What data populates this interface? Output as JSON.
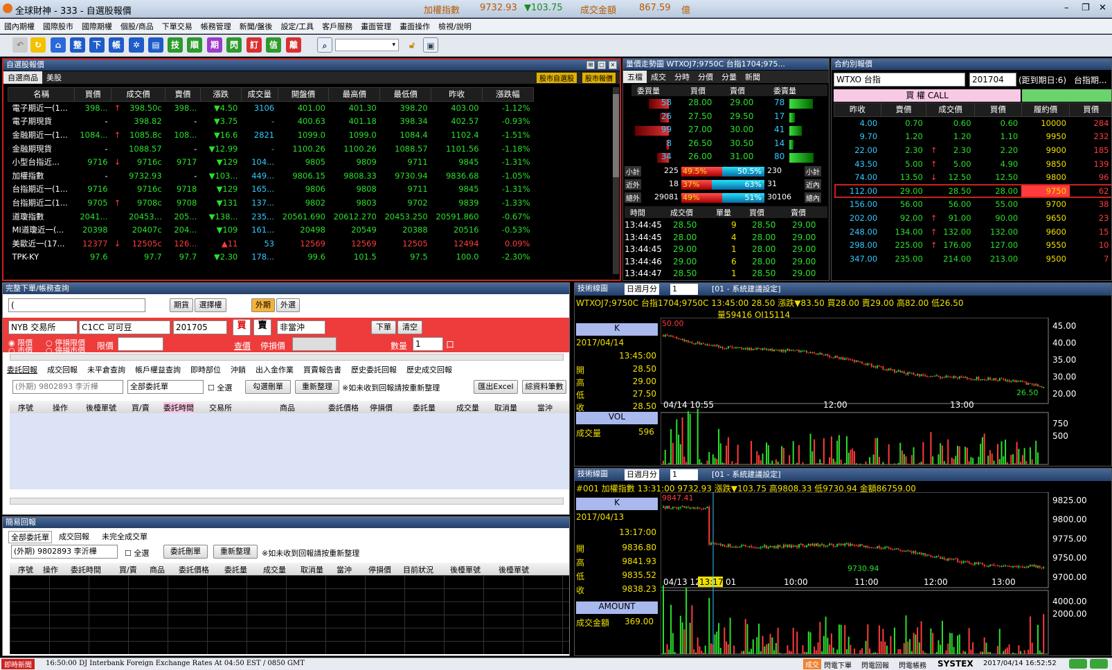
{
  "window": {
    "title": "全球財神 - 333 - 自選股報價",
    "index_label": "加權指數",
    "index_value": "9732.93",
    "index_change": "▼103.75",
    "turnover_label": "成交金額",
    "turnover_value": "867.59",
    "turnover_unit": "億",
    "minimize": "–",
    "restore": "❐",
    "close": "✕"
  },
  "menu": [
    "國內期權",
    "國際股市",
    "國際期權",
    "個股/商品",
    "下單交易",
    "帳務管理",
    "新聞/盤後",
    "設定/工具",
    "客戶服務",
    "畫面管理",
    "畫面操作",
    "檢視/說明"
  ],
  "toolbar": {
    "buttons": [
      "整",
      "下",
      "帳",
      "技",
      "順",
      "期",
      "閃",
      "訂",
      "信",
      "離"
    ]
  },
  "watch": {
    "title": "自選股報價",
    "tabs": [
      "自選商品",
      "美股"
    ],
    "tag1": "股市自選股",
    "tag2": "股市報價",
    "columns": [
      "名稱",
      "買價",
      "成交價",
      "賣價",
      "漲跌",
      "成交量",
      "開盤價",
      "最高價",
      "最低價",
      "昨收",
      "漲跌幅"
    ],
    "rows": [
      {
        "name": "電子期近一(1...",
        "bid": "398...",
        "arrow": "↑",
        "last": "398.50c",
        "ask": "398...",
        "chg": "▼4.50",
        "vol": "3106",
        "open": "401.00",
        "high": "401.30",
        "low": "398.20",
        "prev": "403.00",
        "pct": "-1.12%"
      },
      {
        "name": "電子期現貨",
        "bid": "-",
        "arrow": "",
        "last": "398.82",
        "ask": "-",
        "chg": "▼3.75",
        "vol": "-",
        "open": "400.63",
        "high": "401.18",
        "low": "398.34",
        "prev": "402.57",
        "pct": "-0.93%"
      },
      {
        "name": "金融期近一(1...",
        "bid": "1084...",
        "arrow": "↑",
        "last": "1085.8c",
        "ask": "108...",
        "chg": "▼16.6",
        "vol": "2821",
        "open": "1099.0",
        "high": "1099.0",
        "low": "1084.4",
        "prev": "1102.4",
        "pct": "-1.51%"
      },
      {
        "name": "金融期現貨",
        "bid": "-",
        "arrow": "",
        "last": "1088.57",
        "ask": "-",
        "chg": "▼12.99",
        "vol": "-",
        "open": "1100.26",
        "high": "1100.26",
        "low": "1088.57",
        "prev": "1101.56",
        "pct": "-1.18%"
      },
      {
        "name": "小型台指近...",
        "bid": "9716",
        "arrow": "↓",
        "last": "9716c",
        "ask": "9717",
        "chg": "▼129",
        "vol": "104...",
        "open": "9805",
        "high": "9809",
        "low": "9711",
        "prev": "9845",
        "pct": "-1.31%"
      },
      {
        "name": "加權指數",
        "bid": "-",
        "arrow": "",
        "last": "9732.93",
        "ask": "-",
        "chg": "▼103...",
        "vol": "449...",
        "open": "9806.15",
        "high": "9808.33",
        "low": "9730.94",
        "prev": "9836.68",
        "pct": "-1.05%"
      },
      {
        "name": "台指期近一(1...",
        "bid": "9716",
        "arrow": "",
        "last": "9716c",
        "ask": "9718",
        "chg": "▼129",
        "vol": "165...",
        "open": "9806",
        "high": "9808",
        "low": "9711",
        "prev": "9845",
        "pct": "-1.31%"
      },
      {
        "name": "台指期近二(1...",
        "bid": "9705",
        "arrow": "↑",
        "last": "9708c",
        "ask": "9708",
        "chg": "▼131",
        "vol": "137...",
        "open": "9802",
        "high": "9803",
        "low": "9702",
        "prev": "9839",
        "pct": "-1.33%"
      },
      {
        "name": "道瓊指數",
        "bid": "2041...",
        "arrow": "",
        "last": "20453...",
        "ask": "205...",
        "chg": "▼138...",
        "vol": "235...",
        "open": "20561.690",
        "high": "20612.270",
        "low": "20453.250",
        "prev": "20591.860",
        "pct": "-0.67%"
      },
      {
        "name": "MI道瓊近一(...",
        "bid": "20398",
        "arrow": "",
        "last": "20407c",
        "ask": "204...",
        "chg": "▼109",
        "vol": "161...",
        "open": "20498",
        "high": "20549",
        "low": "20388",
        "prev": "20516",
        "pct": "-0.53%"
      },
      {
        "name": "美歐近一(17...",
        "bid": "12377",
        "arrow": "↓",
        "last": "12505c",
        "ask": "126...",
        "chg": "▲11",
        "vol": "53",
        "open": "12569",
        "high": "12569",
        "low": "12505",
        "prev": "12494",
        "pct": "0.09%"
      },
      {
        "name": "TPK-KY",
        "bid": "97.6",
        "arrow": "",
        "last": "97.7",
        "ask": "97.7",
        "chg": "▼2.30",
        "vol": "178...",
        "open": "99.6",
        "high": "101.5",
        "low": "97.5",
        "prev": "100.0",
        "pct": "-2.30%"
      }
    ]
  },
  "depth": {
    "title": "量價走勢圖 WTXOJ7;9750C 台指1704;975...",
    "tabs": [
      "五檔",
      "成交",
      "分時",
      "分價",
      "分量",
      "新聞"
    ],
    "columns": [
      "委買量",
      "買價",
      "賣價",
      "委賣量"
    ],
    "levels": [
      {
        "bq": "58",
        "bp": "28.00",
        "ap": "29.00",
        "aq": "78",
        "bw": 0.32,
        "aw": 0.62
      },
      {
        "bq": "26",
        "bp": "27.50",
        "ap": "29.50",
        "aq": "17",
        "bw": 0.14,
        "aw": 0.14
      },
      {
        "bq": "99",
        "bp": "27.00",
        "ap": "30.00",
        "aq": "41",
        "bw": 0.55,
        "aw": 0.33
      },
      {
        "bq": "8",
        "bp": "26.50",
        "ap": "30.50",
        "aq": "14",
        "bw": 0.05,
        "aw": 0.11
      },
      {
        "bq": "34",
        "bp": "26.00",
        "ap": "31.00",
        "aq": "80",
        "bw": 0.19,
        "aw": 0.64
      }
    ],
    "summary": [
      {
        "l": "小計",
        "v1": "225",
        "p1": "49.5%",
        "p2": "50.5%",
        "v2": "230",
        "r": "小計",
        "f": 0.495
      },
      {
        "l": "近外",
        "v1": "18",
        "p1": "37%",
        "p2": "63%",
        "v2": "31",
        "r": "近內",
        "f": 0.37
      },
      {
        "l": "總外",
        "v1": "29081",
        "p1": "49%",
        "p2": "51%",
        "v2": "30106",
        "r": "總內",
        "f": 0.49
      }
    ],
    "tick_columns": [
      "時間",
      "成交價",
      "單量",
      "買價",
      "賣價"
    ],
    "ticks": [
      [
        "13:44:45",
        "28.50",
        "9",
        "28.50",
        "29.00"
      ],
      [
        "13:44:45",
        "28.00",
        "4",
        "28.00",
        "29.00"
      ],
      [
        "13:44:45",
        "29.00",
        "1",
        "28.00",
        "29.00"
      ],
      [
        "13:44:46",
        "29.00",
        "6",
        "28.00",
        "29.00"
      ],
      [
        "13:44:47",
        "28.50",
        "1",
        "28.50",
        "29.00"
      ]
    ]
  },
  "options": {
    "title": "合約別報價",
    "product": "WTXO 台指",
    "month": "201704",
    "days": "(距到期日:6)",
    "right": "台指期...",
    "call_label": "買 權 CALL",
    "columns": [
      "昨收",
      "賣價",
      "成交價",
      "買價",
      "履約價",
      "買價"
    ],
    "rows": [
      {
        "prev": "4.00",
        "ask": "0.70",
        "ar": "",
        "last": "0.60",
        "bid": "0.60",
        "strike": "10000",
        "pb": "284"
      },
      {
        "prev": "9.70",
        "ask": "1.20",
        "ar": "",
        "last": "1.20",
        "bid": "1.10",
        "strike": "9950",
        "pb": "232"
      },
      {
        "prev": "22.00",
        "ask": "2.30",
        "ar": "↑",
        "last": "2.30",
        "bid": "2.20",
        "strike": "9900",
        "pb": "185"
      },
      {
        "prev": "43.50",
        "ask": "5.00",
        "ar": "↑",
        "last": "5.00",
        "bid": "4.90",
        "strike": "9850",
        "pb": "139"
      },
      {
        "prev": "74.00",
        "ask": "13.50",
        "ar": "↓",
        "last": "12.50",
        "bid": "12.50",
        "strike": "9800",
        "pb": "96"
      },
      {
        "prev": "112.00",
        "ask": "29.00",
        "ar": "",
        "last": "28.50",
        "bid": "28.00",
        "strike": "9750",
        "pb": "62"
      },
      {
        "prev": "156.00",
        "ask": "56.00",
        "ar": "",
        "last": "56.00",
        "bid": "55.00",
        "strike": "9700",
        "pb": "38"
      },
      {
        "prev": "202.00",
        "ask": "92.00",
        "ar": "↑",
        "last": "91.00",
        "bid": "90.00",
        "strike": "9650",
        "pb": "23"
      },
      {
        "prev": "248.00",
        "ask": "134.00",
        "ar": "↑",
        "last": "132.00",
        "bid": "132.00",
        "strike": "9600",
        "pb": "15"
      },
      {
        "prev": "298.00",
        "ask": "225.00",
        "ar": "↑",
        "last": "176.00",
        "bid": "127.00",
        "strike": "9550",
        "pb": "10"
      },
      {
        "prev": "347.00",
        "ask": "235.00",
        "ar": "",
        "last": "214.00",
        "bid": "213.00",
        "strike": "9500",
        "pb": "7"
      }
    ]
  },
  "order": {
    "title": "完整下單/帳務查詢",
    "acct": "(",
    "btn_futures": "期貨",
    "btn_options": "選擇權",
    "btn_foreign_fut": "外期",
    "btn_foreign_opt": "外選",
    "exchange": "NYB 交易所",
    "product": "C1CC 可可豆",
    "month": "201705",
    "buy": "買",
    "sell": "賣",
    "offset": "非當沖",
    "place": "下單",
    "clear": "清空",
    "radio_limit": "限價",
    "radio_stop_limit": "停損限價",
    "radio_market": "市價",
    "radio_stop_market": "停損市價",
    "price_label": "限價",
    "query": "查價",
    "stop_label": "停損價",
    "qty_label": "數量",
    "qty": "1",
    "lot": "口",
    "tabs": [
      "委託回報",
      "成交回報",
      "未平倉查詢",
      "帳戶權益查詢",
      "即時部位",
      "沖銷",
      "出入金作業",
      "買賣報告書",
      "歷史委託回報",
      "歷史成交回報"
    ],
    "account": "(外期) 9802893 李沂樺",
    "filter": "全部委託單",
    "check_all": "全選",
    "btn_cancel": "勾選刪單",
    "btn_refresh": "重新整理",
    "note": "※如未收到回報請按重新整理",
    "btn_excel": "匯出Excel",
    "btn_more": "綜資料筆數",
    "columns": [
      "序號",
      "操作",
      "後檯單號",
      "買/賣",
      "委託時間",
      "交易所",
      "商品",
      "委託價格",
      "停損價",
      "委託量",
      "成交量",
      "取消量",
      "當沖"
    ]
  },
  "simple": {
    "title": "簡易回報",
    "tabs": [
      "全部委託單",
      "成交回報",
      "未完全成交單"
    ],
    "account": "(外期) 9802893 李沂樺",
    "check_all": "全選",
    "btn_cancel": "委託刪單",
    "btn_refresh": "重新整理",
    "note": "※如未收到回報請按重新整理",
    "columns": [
      "序號",
      "操作",
      "委託時間",
      "買/賣",
      "商品",
      "委託價格",
      "委託量",
      "成交量",
      "取消量",
      "當沖",
      "停損價",
      "目前狀況",
      "後檯單號",
      "後檯單號"
    ]
  },
  "chart1": {
    "title": "技術線圖",
    "period": "日週月分",
    "num": "1",
    "setting": "[01 - 系統建議設定]",
    "info": "WTXOJ7;9750C 台指1704;9750C 13:45:00  28.50  漲跌▼83.50  買28.00  賣29.00  高82.00  低26.50",
    "info2": "量59416   OI15114",
    "k_label": "K",
    "date": "2017/04/14",
    "time": "13:45:00",
    "open_l": "開",
    "open": "28.50",
    "high_l": "高",
    "high": "29.00",
    "low_l": "低",
    "low": "27.50",
    "close_l": "收",
    "close": "28.50",
    "max_label": "50.00",
    "min_label": "26.50",
    "y_ticks": [
      "45.00",
      "40.00",
      "35.00",
      "30.00",
      "20.00"
    ],
    "x_ticks": [
      "04/14 10:55",
      "12:00",
      "13:00"
    ],
    "vol_label": "VOL",
    "vol_name": "成交量",
    "vol_value": "596",
    "vol_ticks": [
      "750",
      "500"
    ]
  },
  "chart2": {
    "title": "技術線圖",
    "period": "日週月分",
    "num": "1",
    "setting": "[01 - 系統建議設定]",
    "info": "#001 加權指數  13:31:00    9732.93   漲跌▼103.75   高9808.33   低9730.94   金額86759.00",
    "k_label": "K",
    "date": "2017/04/13",
    "time": "13:17:00",
    "open_l": "開",
    "open": "9836.80",
    "high_l": "高",
    "high": "9841.93",
    "low_l": "低",
    "low": "9835.52",
    "close_l": "收",
    "close": "9838.23",
    "max_label": "9847.41",
    "min_label": "9730.94",
    "y_ticks": [
      "9825.00",
      "9800.00",
      "9775.00",
      "9750.00",
      "9700.00"
    ],
    "x_ticks": [
      "04/13 12:",
      "13:17",
      "01",
      "10:00",
      "11:00",
      "12:00",
      "13:00"
    ],
    "amt_label": "AMOUNT",
    "amt_name": "成交金額",
    "amt_value": "369.00",
    "amt_ticks": [
      "4000.00",
      "2000.00"
    ]
  },
  "status": {
    "news_label": "即時新聞",
    "news": "16:50:00 DJ Interbank Foreign Exchange Rates At 04:50 EST / 0850 GMT",
    "b1": "成交",
    "b2": "閃電下單",
    "b3": "閃電回報",
    "b4": "閃電帳務",
    "brand": "SYSTEX",
    "clock": "2017/04/14 16:52:52"
  },
  "colors": {
    "up": "#ff3b3b",
    "down": "#2be02b",
    "accent": "#f0e000",
    "order_bg": "#ee3b3b"
  }
}
